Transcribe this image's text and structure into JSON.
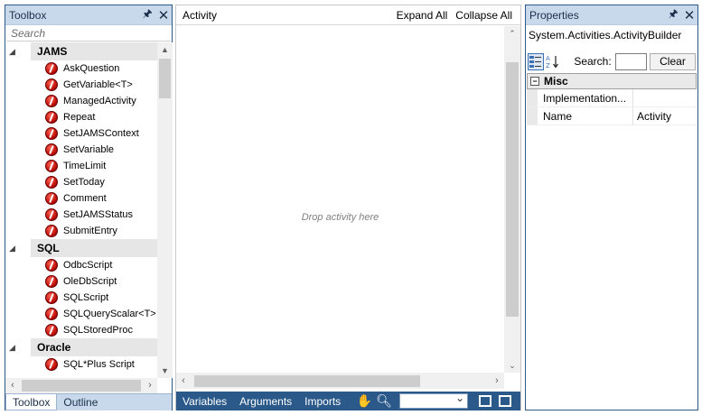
{
  "toolbox": {
    "title": "Toolbox",
    "pin_glyph": "🖈",
    "close_glyph": "✕",
    "search_placeholder": "Search",
    "categories": [
      {
        "name": "JAMS",
        "items": [
          "AskQuestion",
          "GetVariable<T>",
          "ManagedActivity",
          "Repeat",
          "SetJAMSContext",
          "SetVariable",
          "TimeLimit",
          "SetToday",
          "Comment",
          "SetJAMSStatus",
          "SubmitEntry"
        ]
      },
      {
        "name": "SQL",
        "items": [
          "OdbcScript",
          "OleDbScript",
          "SQLScript",
          "SQLQueryScalar<T>",
          "SQLStoredProc"
        ]
      },
      {
        "name": "Oracle",
        "items": [
          "SQL*Plus Script"
        ]
      }
    ],
    "tabs": [
      "Toolbox",
      "Outline"
    ],
    "active_tab": "Toolbox"
  },
  "designer": {
    "title": "Activity",
    "expand_all": "Expand All",
    "collapse_all": "Collapse All",
    "drop_hint": "Drop activity here",
    "bottom_tabs": [
      "Variables",
      "Arguments",
      "Imports"
    ]
  },
  "properties": {
    "title": "Properties",
    "pin_glyph": "🖈",
    "close_glyph": "✕",
    "object_type": "System.Activities.ActivityBuilder",
    "search_label": "Search:",
    "search_value": "",
    "clear_label": "Clear",
    "categories": [
      {
        "name": "Misc",
        "rows": [
          {
            "name": "Implementation...",
            "value": ""
          },
          {
            "name": "Name",
            "value": "Activity"
          }
        ]
      }
    ]
  },
  "icons": {
    "activity_icon": "jams-activity-icon",
    "hand_icon": "hand-pan-icon",
    "zoom_icon": "magnifier-icon",
    "fit_icon": "fit-to-screen-icon",
    "overview_icon": "overview-icon"
  },
  "colors": {
    "panel_title_bg": "#c9d9ec",
    "accent_bar": "#2b5a8a",
    "activity_icon": "#c0100a"
  }
}
